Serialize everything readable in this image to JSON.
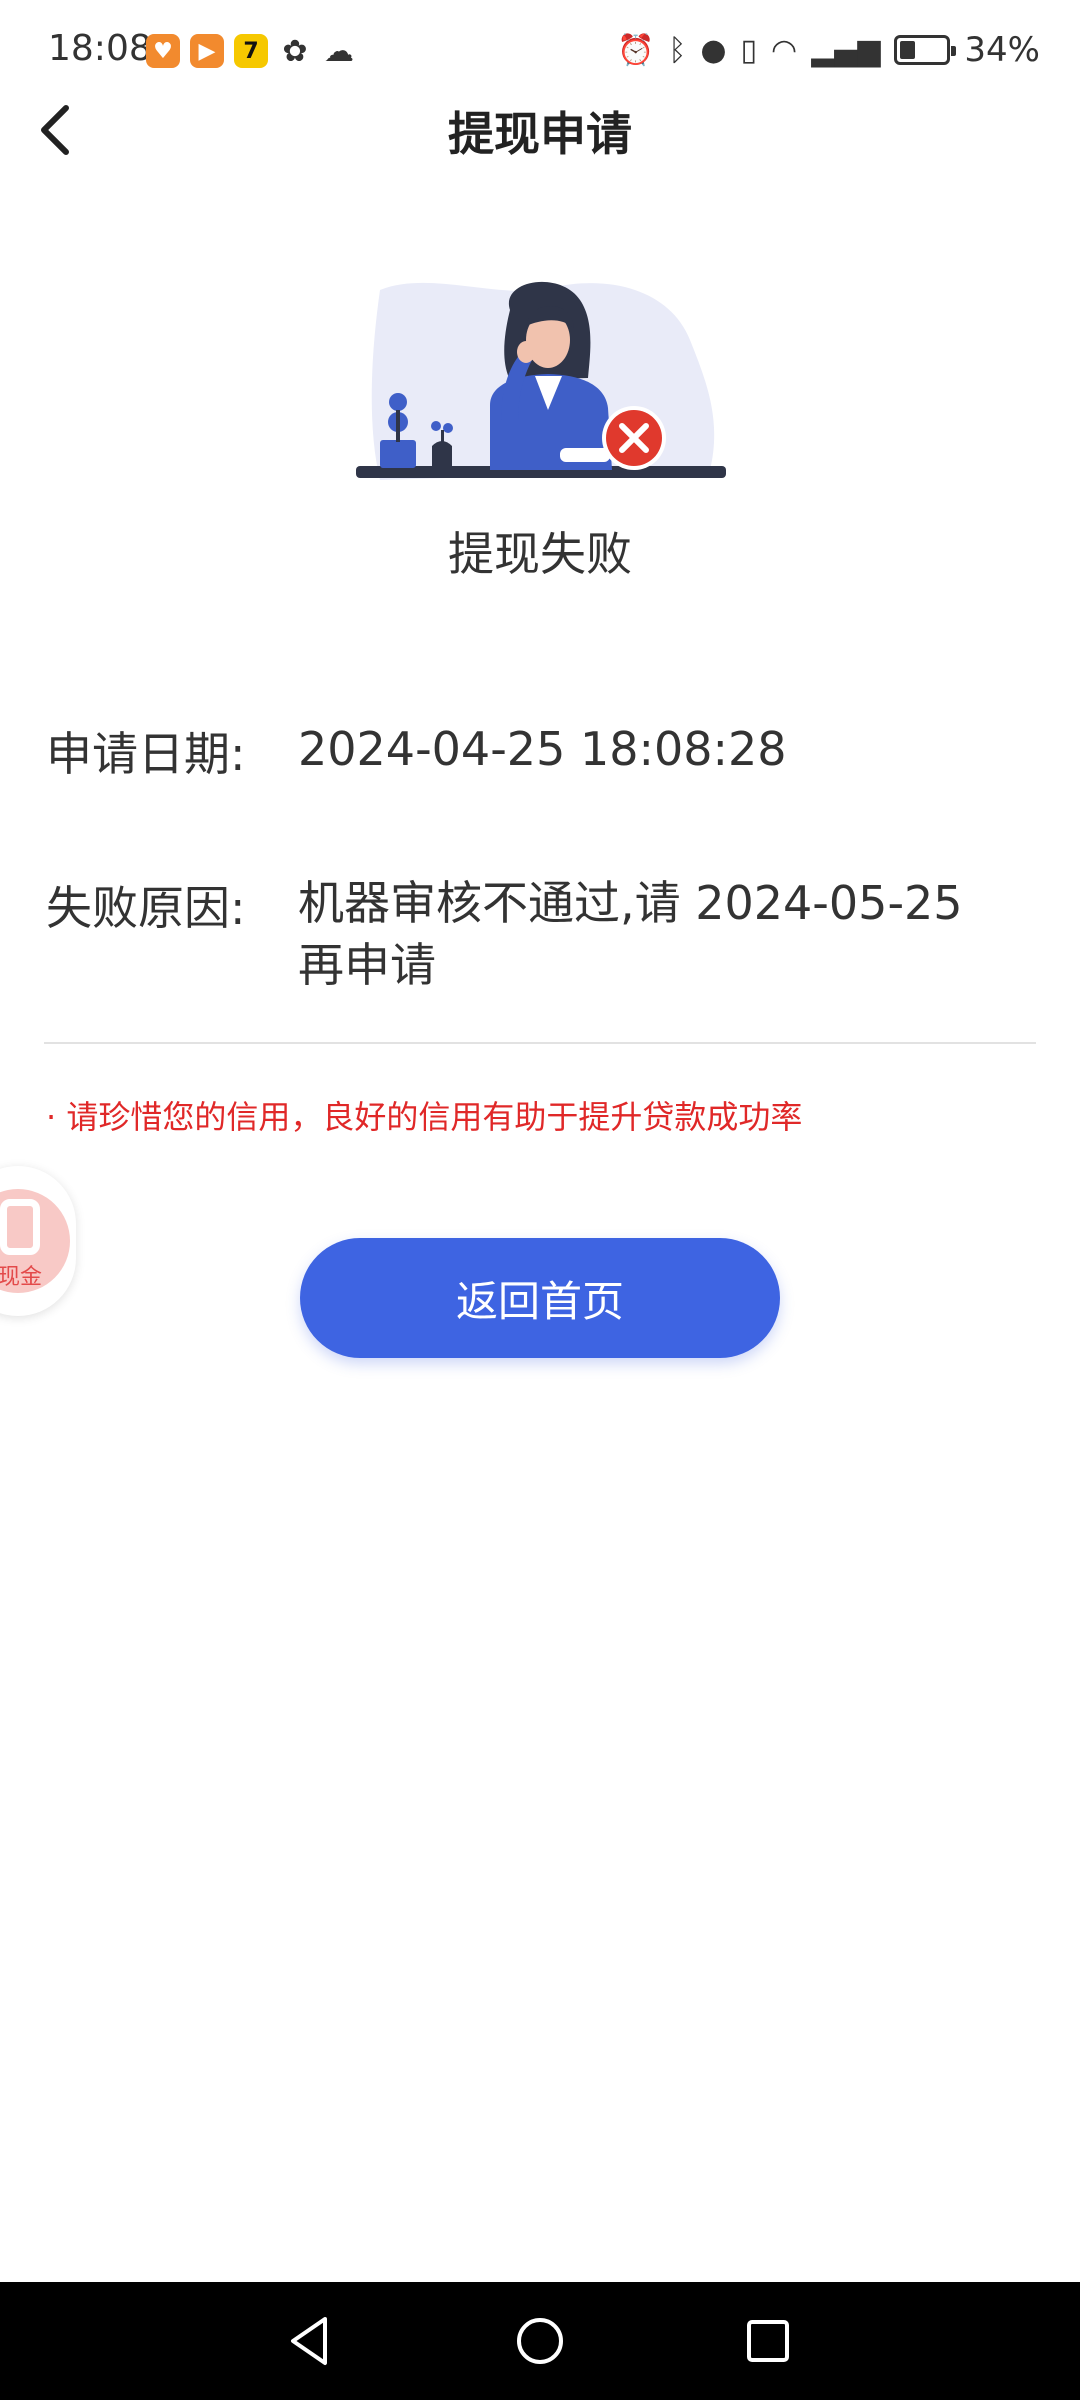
{
  "status_bar": {
    "time": "18:08",
    "battery": "34%",
    "battery_level": 0.34,
    "icons": [
      "notification-app-icon",
      "video-app-icon",
      "seven-app-icon",
      "paw-app-icon",
      "wechat-icon",
      "alarm-icon",
      "bluetooth-icon",
      "location-icon",
      "vibrate-icon",
      "wifi-icon",
      "signal-5g-icon",
      "battery-icon"
    ]
  },
  "header": {
    "title": "提现申请",
    "back_icon": "chevron-left-icon"
  },
  "result": {
    "illustration_icon": "failure-illustration",
    "heading": "提现失败"
  },
  "details": {
    "date_label": "申请日期:",
    "date_value": "2024-04-25 18:08:28",
    "reason_label": "失败原因:",
    "reason_value_line1": "机器审核不通过,请 2024-05-25",
    "reason_value_line2": "再申请"
  },
  "tip": "· 请珍惜您的信用，良好的信用有助于提升贷款成功率",
  "float_badge": {
    "caption": "现金",
    "icon": "cash-float-icon"
  },
  "actions": {
    "home_button": "返回首页"
  },
  "colors": {
    "primary": "#3e64e2",
    "error": "#e02828",
    "badge": "#f8c9c6"
  },
  "nav_bar": {
    "back_icon": "triangle-back-icon",
    "home_icon": "circle-home-icon",
    "recent_icon": "square-recents-icon"
  }
}
